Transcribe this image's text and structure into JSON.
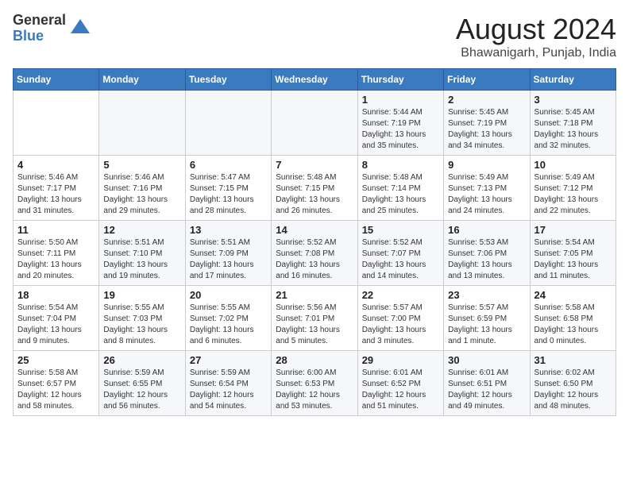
{
  "logo": {
    "line1": "General",
    "line2": "Blue"
  },
  "title": "August 2024",
  "subtitle": "Bhawanigarh, Punjab, India",
  "weekdays": [
    "Sunday",
    "Monday",
    "Tuesday",
    "Wednesday",
    "Thursday",
    "Friday",
    "Saturday"
  ],
  "weeks": [
    [
      {
        "day": "",
        "info": ""
      },
      {
        "day": "",
        "info": ""
      },
      {
        "day": "",
        "info": ""
      },
      {
        "day": "",
        "info": ""
      },
      {
        "day": "1",
        "info": "Sunrise: 5:44 AM\nSunset: 7:19 PM\nDaylight: 13 hours\nand 35 minutes."
      },
      {
        "day": "2",
        "info": "Sunrise: 5:45 AM\nSunset: 7:19 PM\nDaylight: 13 hours\nand 34 minutes."
      },
      {
        "day": "3",
        "info": "Sunrise: 5:45 AM\nSunset: 7:18 PM\nDaylight: 13 hours\nand 32 minutes."
      }
    ],
    [
      {
        "day": "4",
        "info": "Sunrise: 5:46 AM\nSunset: 7:17 PM\nDaylight: 13 hours\nand 31 minutes."
      },
      {
        "day": "5",
        "info": "Sunrise: 5:46 AM\nSunset: 7:16 PM\nDaylight: 13 hours\nand 29 minutes."
      },
      {
        "day": "6",
        "info": "Sunrise: 5:47 AM\nSunset: 7:15 PM\nDaylight: 13 hours\nand 28 minutes."
      },
      {
        "day": "7",
        "info": "Sunrise: 5:48 AM\nSunset: 7:15 PM\nDaylight: 13 hours\nand 26 minutes."
      },
      {
        "day": "8",
        "info": "Sunrise: 5:48 AM\nSunset: 7:14 PM\nDaylight: 13 hours\nand 25 minutes."
      },
      {
        "day": "9",
        "info": "Sunrise: 5:49 AM\nSunset: 7:13 PM\nDaylight: 13 hours\nand 24 minutes."
      },
      {
        "day": "10",
        "info": "Sunrise: 5:49 AM\nSunset: 7:12 PM\nDaylight: 13 hours\nand 22 minutes."
      }
    ],
    [
      {
        "day": "11",
        "info": "Sunrise: 5:50 AM\nSunset: 7:11 PM\nDaylight: 13 hours\nand 20 minutes."
      },
      {
        "day": "12",
        "info": "Sunrise: 5:51 AM\nSunset: 7:10 PM\nDaylight: 13 hours\nand 19 minutes."
      },
      {
        "day": "13",
        "info": "Sunrise: 5:51 AM\nSunset: 7:09 PM\nDaylight: 13 hours\nand 17 minutes."
      },
      {
        "day": "14",
        "info": "Sunrise: 5:52 AM\nSunset: 7:08 PM\nDaylight: 13 hours\nand 16 minutes."
      },
      {
        "day": "15",
        "info": "Sunrise: 5:52 AM\nSunset: 7:07 PM\nDaylight: 13 hours\nand 14 minutes."
      },
      {
        "day": "16",
        "info": "Sunrise: 5:53 AM\nSunset: 7:06 PM\nDaylight: 13 hours\nand 13 minutes."
      },
      {
        "day": "17",
        "info": "Sunrise: 5:54 AM\nSunset: 7:05 PM\nDaylight: 13 hours\nand 11 minutes."
      }
    ],
    [
      {
        "day": "18",
        "info": "Sunrise: 5:54 AM\nSunset: 7:04 PM\nDaylight: 13 hours\nand 9 minutes."
      },
      {
        "day": "19",
        "info": "Sunrise: 5:55 AM\nSunset: 7:03 PM\nDaylight: 13 hours\nand 8 minutes."
      },
      {
        "day": "20",
        "info": "Sunrise: 5:55 AM\nSunset: 7:02 PM\nDaylight: 13 hours\nand 6 minutes."
      },
      {
        "day": "21",
        "info": "Sunrise: 5:56 AM\nSunset: 7:01 PM\nDaylight: 13 hours\nand 5 minutes."
      },
      {
        "day": "22",
        "info": "Sunrise: 5:57 AM\nSunset: 7:00 PM\nDaylight: 13 hours\nand 3 minutes."
      },
      {
        "day": "23",
        "info": "Sunrise: 5:57 AM\nSunset: 6:59 PM\nDaylight: 13 hours\nand 1 minute."
      },
      {
        "day": "24",
        "info": "Sunrise: 5:58 AM\nSunset: 6:58 PM\nDaylight: 13 hours\nand 0 minutes."
      }
    ],
    [
      {
        "day": "25",
        "info": "Sunrise: 5:58 AM\nSunset: 6:57 PM\nDaylight: 12 hours\nand 58 minutes."
      },
      {
        "day": "26",
        "info": "Sunrise: 5:59 AM\nSunset: 6:55 PM\nDaylight: 12 hours\nand 56 minutes."
      },
      {
        "day": "27",
        "info": "Sunrise: 5:59 AM\nSunset: 6:54 PM\nDaylight: 12 hours\nand 54 minutes."
      },
      {
        "day": "28",
        "info": "Sunrise: 6:00 AM\nSunset: 6:53 PM\nDaylight: 12 hours\nand 53 minutes."
      },
      {
        "day": "29",
        "info": "Sunrise: 6:01 AM\nSunset: 6:52 PM\nDaylight: 12 hours\nand 51 minutes."
      },
      {
        "day": "30",
        "info": "Sunrise: 6:01 AM\nSunset: 6:51 PM\nDaylight: 12 hours\nand 49 minutes."
      },
      {
        "day": "31",
        "info": "Sunrise: 6:02 AM\nSunset: 6:50 PM\nDaylight: 12 hours\nand 48 minutes."
      }
    ]
  ]
}
